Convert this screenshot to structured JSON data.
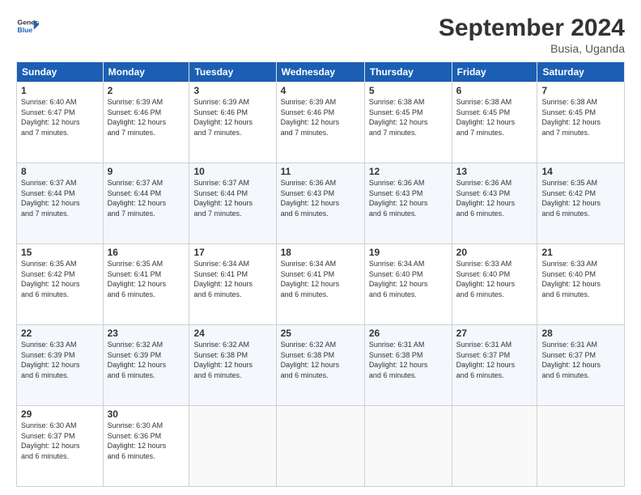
{
  "logo": {
    "line1": "General",
    "line2": "Blue"
  },
  "header": {
    "month": "September 2024",
    "location": "Busia, Uganda"
  },
  "days_of_week": [
    "Sunday",
    "Monday",
    "Tuesday",
    "Wednesday",
    "Thursday",
    "Friday",
    "Saturday"
  ],
  "weeks": [
    [
      {
        "day": "1",
        "info": "Sunrise: 6:40 AM\nSunset: 6:47 PM\nDaylight: 12 hours\nand 7 minutes."
      },
      {
        "day": "2",
        "info": "Sunrise: 6:39 AM\nSunset: 6:46 PM\nDaylight: 12 hours\nand 7 minutes."
      },
      {
        "day": "3",
        "info": "Sunrise: 6:39 AM\nSunset: 6:46 PM\nDaylight: 12 hours\nand 7 minutes."
      },
      {
        "day": "4",
        "info": "Sunrise: 6:39 AM\nSunset: 6:46 PM\nDaylight: 12 hours\nand 7 minutes."
      },
      {
        "day": "5",
        "info": "Sunrise: 6:38 AM\nSunset: 6:45 PM\nDaylight: 12 hours\nand 7 minutes."
      },
      {
        "day": "6",
        "info": "Sunrise: 6:38 AM\nSunset: 6:45 PM\nDaylight: 12 hours\nand 7 minutes."
      },
      {
        "day": "7",
        "info": "Sunrise: 6:38 AM\nSunset: 6:45 PM\nDaylight: 12 hours\nand 7 minutes."
      }
    ],
    [
      {
        "day": "8",
        "info": "Sunrise: 6:37 AM\nSunset: 6:44 PM\nDaylight: 12 hours\nand 7 minutes."
      },
      {
        "day": "9",
        "info": "Sunrise: 6:37 AM\nSunset: 6:44 PM\nDaylight: 12 hours\nand 7 minutes."
      },
      {
        "day": "10",
        "info": "Sunrise: 6:37 AM\nSunset: 6:44 PM\nDaylight: 12 hours\nand 7 minutes."
      },
      {
        "day": "11",
        "info": "Sunrise: 6:36 AM\nSunset: 6:43 PM\nDaylight: 12 hours\nand 6 minutes."
      },
      {
        "day": "12",
        "info": "Sunrise: 6:36 AM\nSunset: 6:43 PM\nDaylight: 12 hours\nand 6 minutes."
      },
      {
        "day": "13",
        "info": "Sunrise: 6:36 AM\nSunset: 6:43 PM\nDaylight: 12 hours\nand 6 minutes."
      },
      {
        "day": "14",
        "info": "Sunrise: 6:35 AM\nSunset: 6:42 PM\nDaylight: 12 hours\nand 6 minutes."
      }
    ],
    [
      {
        "day": "15",
        "info": "Sunrise: 6:35 AM\nSunset: 6:42 PM\nDaylight: 12 hours\nand 6 minutes."
      },
      {
        "day": "16",
        "info": "Sunrise: 6:35 AM\nSunset: 6:41 PM\nDaylight: 12 hours\nand 6 minutes."
      },
      {
        "day": "17",
        "info": "Sunrise: 6:34 AM\nSunset: 6:41 PM\nDaylight: 12 hours\nand 6 minutes."
      },
      {
        "day": "18",
        "info": "Sunrise: 6:34 AM\nSunset: 6:41 PM\nDaylight: 12 hours\nand 6 minutes."
      },
      {
        "day": "19",
        "info": "Sunrise: 6:34 AM\nSunset: 6:40 PM\nDaylight: 12 hours\nand 6 minutes."
      },
      {
        "day": "20",
        "info": "Sunrise: 6:33 AM\nSunset: 6:40 PM\nDaylight: 12 hours\nand 6 minutes."
      },
      {
        "day": "21",
        "info": "Sunrise: 6:33 AM\nSunset: 6:40 PM\nDaylight: 12 hours\nand 6 minutes."
      }
    ],
    [
      {
        "day": "22",
        "info": "Sunrise: 6:33 AM\nSunset: 6:39 PM\nDaylight: 12 hours\nand 6 minutes."
      },
      {
        "day": "23",
        "info": "Sunrise: 6:32 AM\nSunset: 6:39 PM\nDaylight: 12 hours\nand 6 minutes."
      },
      {
        "day": "24",
        "info": "Sunrise: 6:32 AM\nSunset: 6:38 PM\nDaylight: 12 hours\nand 6 minutes."
      },
      {
        "day": "25",
        "info": "Sunrise: 6:32 AM\nSunset: 6:38 PM\nDaylight: 12 hours\nand 6 minutes."
      },
      {
        "day": "26",
        "info": "Sunrise: 6:31 AM\nSunset: 6:38 PM\nDaylight: 12 hours\nand 6 minutes."
      },
      {
        "day": "27",
        "info": "Sunrise: 6:31 AM\nSunset: 6:37 PM\nDaylight: 12 hours\nand 6 minutes."
      },
      {
        "day": "28",
        "info": "Sunrise: 6:31 AM\nSunset: 6:37 PM\nDaylight: 12 hours\nand 6 minutes."
      }
    ],
    [
      {
        "day": "29",
        "info": "Sunrise: 6:30 AM\nSunset: 6:37 PM\nDaylight: 12 hours\nand 6 minutes."
      },
      {
        "day": "30",
        "info": "Sunrise: 6:30 AM\nSunset: 6:36 PM\nDaylight: 12 hours\nand 6 minutes."
      },
      null,
      null,
      null,
      null,
      null
    ]
  ]
}
